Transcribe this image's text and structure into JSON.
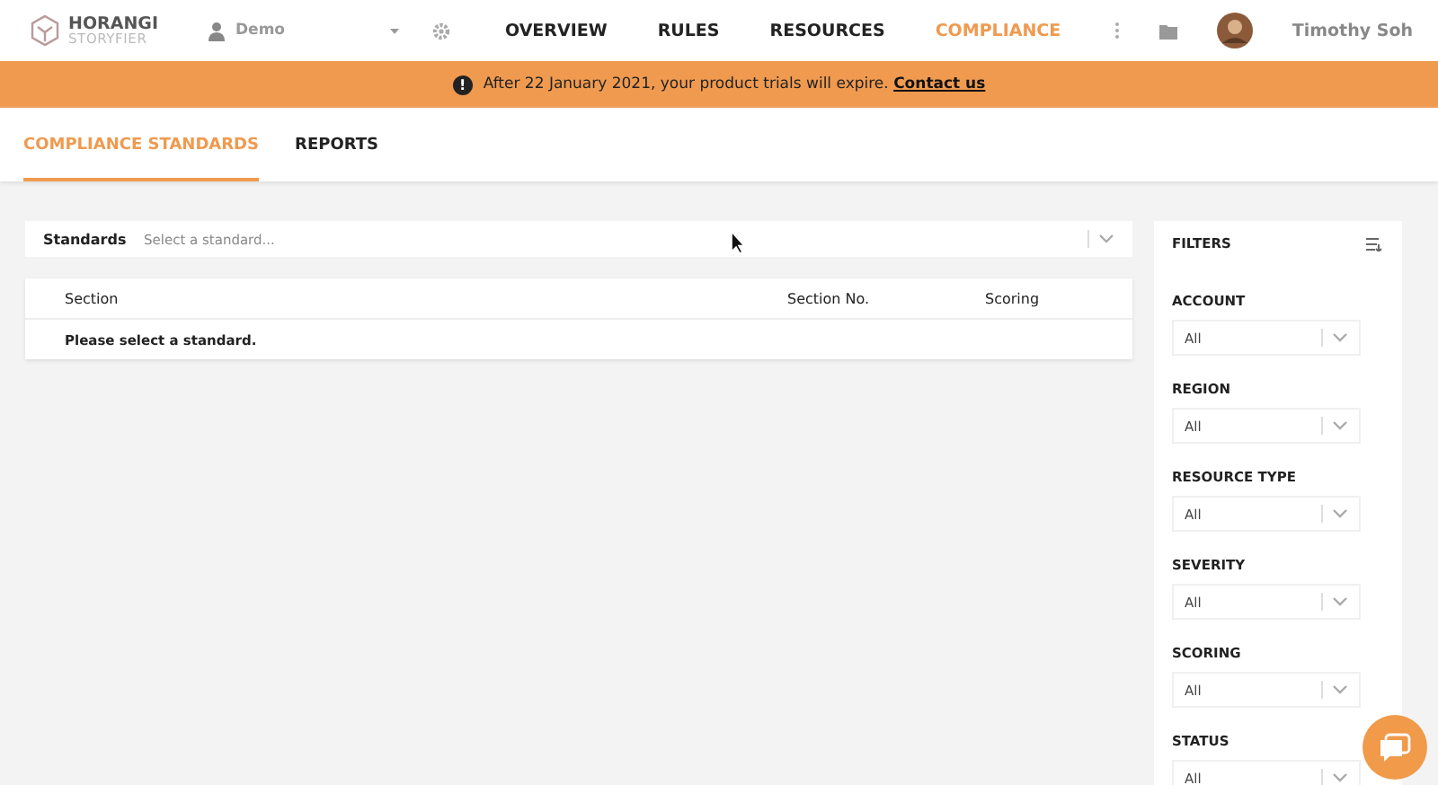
{
  "header": {
    "logo": {
      "name": "HORANGI",
      "sub": "STORYFIER"
    },
    "account": "Demo",
    "nav": [
      {
        "label": "OVERVIEW",
        "selected": false
      },
      {
        "label": "RULES",
        "selected": false
      },
      {
        "label": "RESOURCES",
        "selected": false
      },
      {
        "label": "COMPLIANCE",
        "selected": true
      }
    ],
    "user": "Timothy Soh"
  },
  "banner": {
    "icon": "!",
    "text": "After 22 January 2021, your product trials will expire.",
    "link": "Contact us"
  },
  "tabs": [
    {
      "label": "COMPLIANCE STANDARDS",
      "selected": true
    },
    {
      "label": "REPORTS",
      "selected": false
    }
  ],
  "standards": {
    "label": "Standards",
    "placeholder": "Select a standard..."
  },
  "table": {
    "columns": [
      "Section",
      "Section No.",
      "Scoring"
    ],
    "empty": "Please select a standard."
  },
  "filters": {
    "title": "FILTERS",
    "groups": [
      {
        "label": "ACCOUNT",
        "value": "All"
      },
      {
        "label": "REGION",
        "value": "All"
      },
      {
        "label": "RESOURCE TYPE",
        "value": "All"
      },
      {
        "label": "SEVERITY",
        "value": "All"
      },
      {
        "label": "SCORING",
        "value": "All"
      },
      {
        "label": "STATUS",
        "value": "All"
      }
    ]
  }
}
